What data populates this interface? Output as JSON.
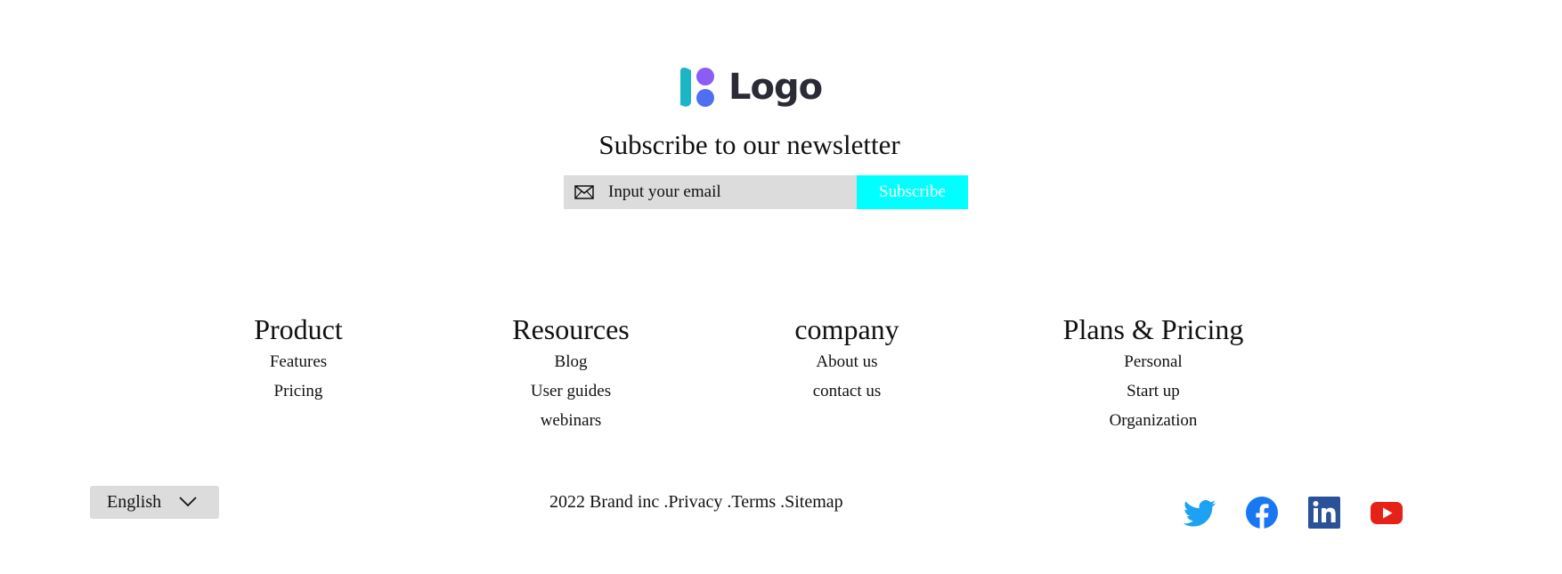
{
  "logo": {
    "text": "Logo"
  },
  "newsletter": {
    "title": "Subscribe to our newsletter",
    "email_placeholder": "Input your email",
    "button_label": "Subscribe"
  },
  "columns": [
    {
      "title": "Product",
      "links": [
        "Features",
        "Pricing"
      ]
    },
    {
      "title": "Resources",
      "links": [
        "Blog",
        "User guides",
        "webinars"
      ]
    },
    {
      "title": "company",
      "links": [
        "About us",
        "contact us"
      ]
    },
    {
      "title": "Plans & Pricing",
      "links": [
        "Personal",
        "Start up",
        "Organization"
      ]
    }
  ],
  "language": {
    "selected": "English"
  },
  "legal": {
    "copyright": "2022 Brand inc",
    "privacy": ".Privacy",
    "terms": ".Terms",
    "sitemap": ".Sitemap"
  },
  "social": [
    {
      "icon": "twitter-icon",
      "color": "#1da1f2"
    },
    {
      "icon": "facebook-icon",
      "color": "#1877f2"
    },
    {
      "icon": "linkedin-icon",
      "color": "#2a5298"
    },
    {
      "icon": "youtube-icon",
      "color": "#e62117"
    }
  ]
}
